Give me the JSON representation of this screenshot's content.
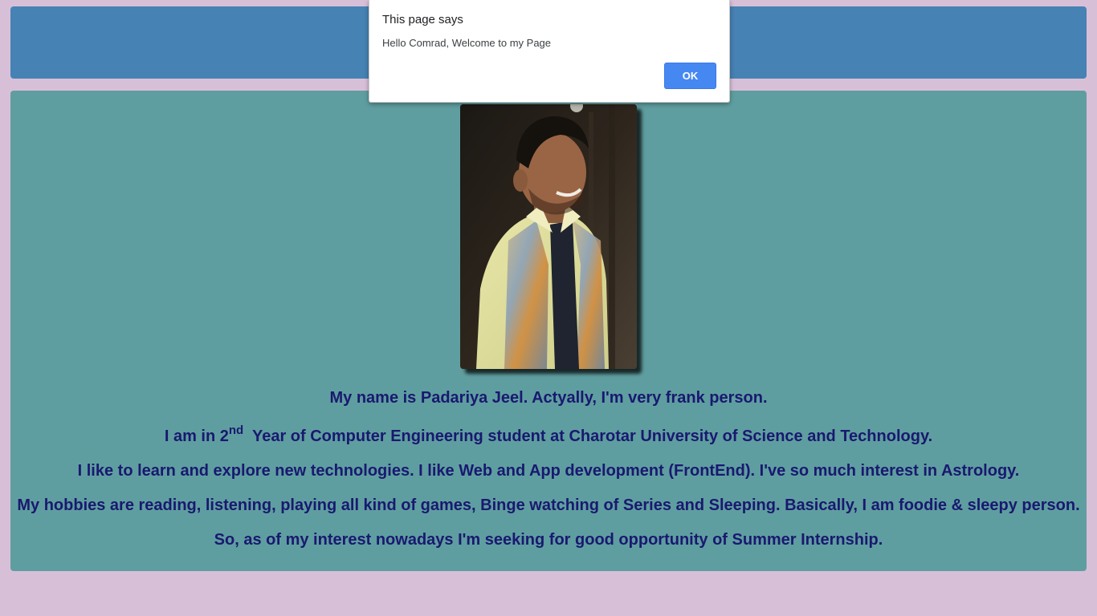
{
  "dialog": {
    "title": "This page says",
    "message": "Hello Comrad, Welcome to my Page",
    "ok_label": "OK"
  },
  "profile": {
    "photo_icon": "portrait-photo"
  },
  "bio": {
    "line1": "My name is Padariya Jeel. Actyally, I'm very frank person.",
    "line2_prefix": "I am in 2",
    "line2_sup": "nd",
    "line2_suffix": "  Year of Computer Engineering student at Charotar University of Science and Technology.",
    "line3": "I like to learn and explore new technologies. I like Web and App development (FrontEnd). I've so much interest in Astrology.",
    "line4": "My hobbies are reading, listening, playing all kind of games, Binge watching of Series and Sleeping. Basically, I am foodie & sleepy person.",
    "line5": "So, as of my interest nowadays I'm seeking for good opportunity of Summer Internship."
  },
  "colors": {
    "page_background": "#d8bfd8",
    "header_background": "#4682b4",
    "content_background": "#5f9ea0",
    "text": "#191970",
    "ok_button": "#4688f1"
  }
}
